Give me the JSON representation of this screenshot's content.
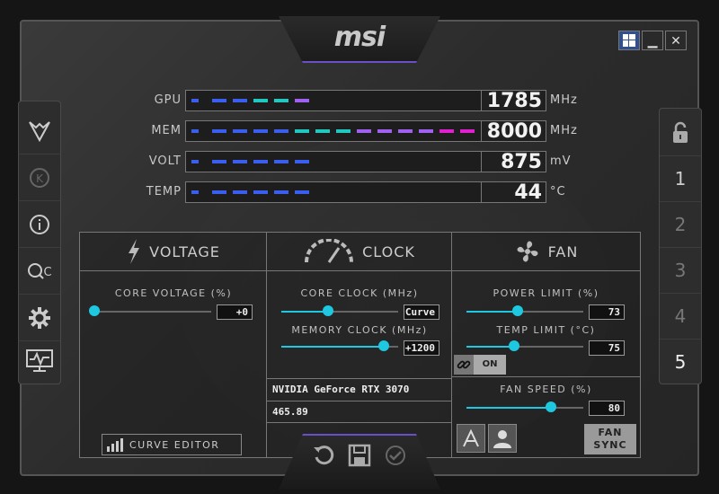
{
  "app": {
    "logo": "msi"
  },
  "window_controls": {
    "minimize": "▁",
    "close": "✕"
  },
  "monitors": [
    {
      "label": "GPU",
      "value": "1785",
      "unit": "MHz",
      "level": 0.45
    },
    {
      "label": "MEM",
      "value": "8000",
      "unit": "MHz",
      "level": 1.0
    },
    {
      "label": "VOLT",
      "value": "875",
      "unit": "mV",
      "level": 0.45
    },
    {
      "label": "TEMP",
      "value": "44",
      "unit": "°C",
      "level": 0.45
    }
  ],
  "right_profiles": [
    "1",
    "2",
    "3",
    "4",
    "5"
  ],
  "active_profile": "5",
  "voltage": {
    "title": "VOLTAGE",
    "core_voltage_label": "CORE VOLTAGE (%)",
    "core_voltage_value": "+0",
    "core_voltage_level": 0.0,
    "curve_editor_label": "CURVE EDITOR"
  },
  "clock": {
    "title": "CLOCK",
    "core_clock_label": "CORE CLOCK (MHz)",
    "core_clock_value": "Curve",
    "core_clock_level": 0.4,
    "memory_clock_label": "MEMORY CLOCK (MHz)",
    "memory_clock_value": "+1200",
    "memory_clock_level": 0.88,
    "gpu_name": "NVIDIA GeForce RTX 3070",
    "driver_version": "465.89"
  },
  "fan": {
    "title": "FAN",
    "power_limit_label": "POWER LIMIT (%)",
    "power_limit_value": "73",
    "power_limit_level": 0.44,
    "temp_limit_label": "TEMP LIMIT (°C)",
    "temp_limit_value": "75",
    "temp_limit_level": 0.41,
    "link_state": "ON",
    "fan_speed_label": "FAN SPEED (%)",
    "fan_speed_value": "80",
    "fan_speed_level": 0.72,
    "fan_sync_line1": "FAN",
    "fan_sync_line2": "SYNC"
  },
  "colors": {
    "slider_accent": "#1ec8e0",
    "bar_blue": "#3a5ff0",
    "bar_cyan": "#20c8c0",
    "bar_purple": "#a060f0",
    "bar_magenta": "#e020d0"
  }
}
